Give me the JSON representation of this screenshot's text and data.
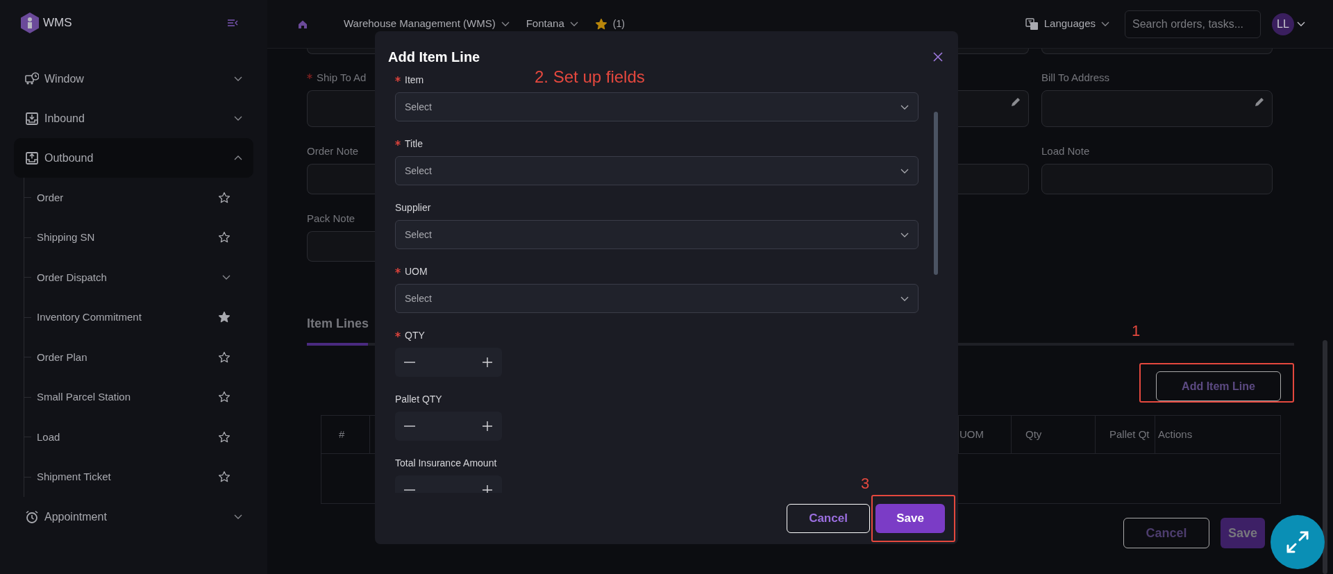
{
  "sidebar": {
    "logo_text": "WMS",
    "items": [
      {
        "label": "Window",
        "expanded": false
      },
      {
        "label": "Inbound",
        "expanded": false
      },
      {
        "label": "Outbound",
        "expanded": true,
        "children": [
          {
            "label": "Order",
            "kind": "favorite",
            "starred": false
          },
          {
            "label": "Shipping SN",
            "kind": "favorite",
            "starred": false
          },
          {
            "label": "Order Dispatch",
            "kind": "group",
            "expanded": false
          },
          {
            "label": "Inventory Commitment",
            "kind": "favorite",
            "starred": true
          },
          {
            "label": "Order Plan",
            "kind": "favorite",
            "starred": false
          },
          {
            "label": "Small Parcel Station",
            "kind": "favorite",
            "starred": false
          },
          {
            "label": "Load",
            "kind": "favorite",
            "starred": false
          },
          {
            "label": "Shipment Ticket",
            "kind": "favorite",
            "starred": false
          }
        ]
      },
      {
        "label": "Appointment",
        "expanded": false
      }
    ]
  },
  "top_bar": {
    "breadcrumbs": [
      {
        "label": "Warehouse Management (WMS)"
      },
      {
        "label": "Fontana"
      }
    ],
    "favorites_count": "(1)",
    "language_label": "Languages",
    "search": {
      "placeholder": "Search orders, tasks..."
    },
    "avatar": "LL"
  },
  "form": {
    "columns": [
      {
        "fields": [
          {
            "label": "Ship To Ad",
            "required": true,
            "kind": "textarea"
          },
          {
            "label": "Order Note",
            "required": false,
            "kind": "input"
          },
          {
            "label": "Pack Note",
            "required": false,
            "kind": "input"
          }
        ]
      },
      {
        "fields": [
          {
            "kind": "textarea"
          },
          {
            "kind": "input"
          }
        ]
      },
      {
        "fields": [
          {
            "label": "Bill To Address",
            "required": false,
            "kind": "textarea"
          },
          {
            "label": "Load Note",
            "required": false,
            "kind": "input"
          }
        ]
      }
    ]
  },
  "item_lines": {
    "tabs": [
      {
        "label": "Item Lines",
        "selected": true
      }
    ],
    "step_marker": "1",
    "add_button": "Add Item Line",
    "table": {
      "columns": [
        "#",
        "UOM",
        "Qty",
        "Pallet Qt",
        "Actions"
      ]
    },
    "buttons": [
      {
        "label": "Cancel",
        "kind": "secondary"
      },
      {
        "label": "Save",
        "kind": "primary"
      }
    ]
  },
  "modal": {
    "title": "Add Item Line",
    "note": "2. Set up fields",
    "fields": [
      {
        "label": "Item",
        "required": true,
        "kind": "select",
        "placeholder": "Select"
      },
      {
        "label": "Title",
        "required": true,
        "kind": "select",
        "placeholder": "Select"
      },
      {
        "label": "Supplier",
        "required": false,
        "kind": "select",
        "placeholder": "Select"
      },
      {
        "label": "UOM",
        "required": true,
        "kind": "select",
        "placeholder": "Select"
      },
      {
        "label": "QTY",
        "required": true,
        "kind": "stepper"
      },
      {
        "label": "Pallet QTY",
        "required": false,
        "kind": "stepper"
      },
      {
        "label": "Total Insurance Amount",
        "required": false,
        "kind": "stepper"
      }
    ],
    "buttons": [
      {
        "label": "Cancel",
        "kind": "secondary"
      },
      {
        "label": "Save",
        "kind": "primary"
      }
    ],
    "step_marker": "3"
  }
}
